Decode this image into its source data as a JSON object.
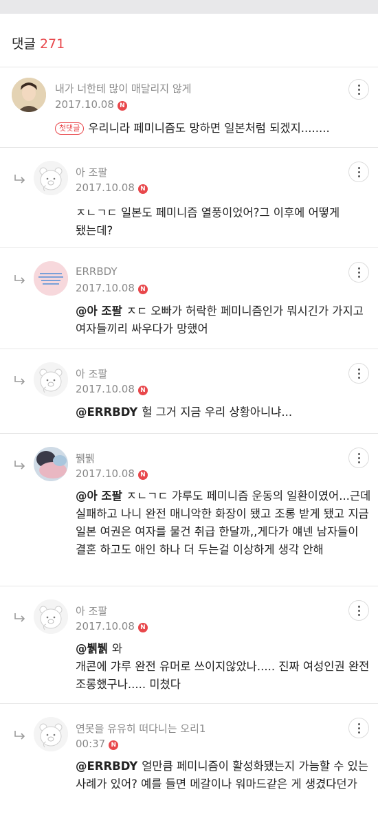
{
  "header": {
    "label": "댓글",
    "count": "271"
  },
  "comments": [
    {
      "name": "내가 너한테 많이 매달리지 않게",
      "date": "2017.10.08",
      "badge": "N",
      "tag": "첫댓글",
      "mention": "",
      "text": "우리니라 페미니즘도 망하면 일본처럼 되겠지........",
      "avatar": "profile-photo"
    },
    {
      "name": "아 조팔",
      "date": "2017.10.08",
      "badge": "N",
      "mention": "",
      "text": "ㅈㄴㄱㄷ 일본도 페미니즘 열풍이었어?그 이후에 어떻게 됐는데?",
      "avatar": "default-bear"
    },
    {
      "name": "ERRBDY",
      "date": "2017.10.08",
      "badge": "N",
      "mention": "@아 조팔",
      "text": "ㅈㄷ 오빠가 허락한 페미니즘인가 뭐시긴가 가지고 여자들끼리 싸우다가 망했어",
      "avatar": "pink-text-image"
    },
    {
      "name": "아 조팔",
      "date": "2017.10.08",
      "badge": "N",
      "mention": "@ERRBDY",
      "text": "헐 그거 지금 우리 상황아니냐...",
      "avatar": "default-bear"
    },
    {
      "name": "뷁뷁",
      "date": "2017.10.08",
      "badge": "N",
      "mention": "@아 조팔",
      "text": "ㅈㄴㄱㄷ 갸루도 페미니즘 운동의 일환이였어...근데 실패하고 나니 완전 매니악한 화장이 됐고 조롱 받게 됐고 지금 일본 여권은 여자를 물건 취급 한달까,,게다가 얘넨 남자들이 결혼 하고도 애인 하나 더 두는걸 이상하게 생각 안해",
      "avatar": "blurry-photo"
    },
    {
      "name": "아 조팔",
      "date": "2017.10.08",
      "badge": "N",
      "mention": "@뷁뷁",
      "text": "와\n개콘에 갸루 완전 유머로 쓰이지않았나..... 진짜 여성인권 완전 조롱했구나..... 미쳤다",
      "avatar": "default-bear"
    },
    {
      "name": "연못을 유유히 떠다니는 오리1",
      "date": "00:37",
      "badge": "N",
      "mention": "@ERRBDY",
      "text": "얼만큼 페미니즘이 활성화됐는지 가늠할 수 있는 사례가 있어? 예를 들면 메갈이나 워마드같은 게 생겼다던가",
      "avatar": "default-bear"
    }
  ],
  "colors": {
    "accent": "#e8474b",
    "meta": "#8a8a8a",
    "divider": "#e6e6e6"
  },
  "icons": {
    "reply": "reply-arrow-icon",
    "more": "more-vertical-icon",
    "new": "new-badge"
  }
}
